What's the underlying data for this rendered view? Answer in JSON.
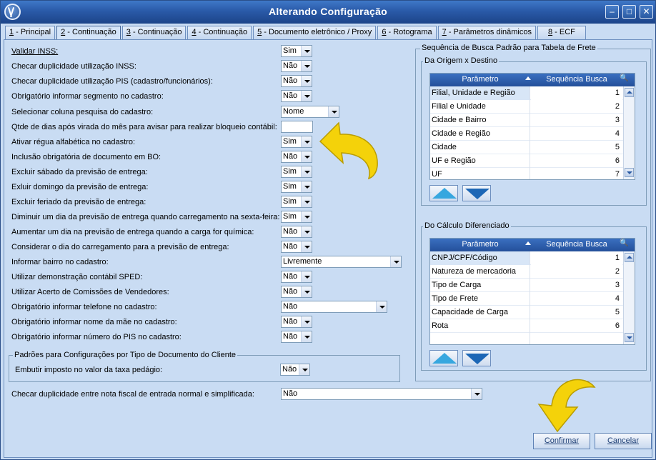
{
  "window": {
    "title": "Alterando Configuração",
    "controls": {
      "minimize": "–",
      "maximize": "□",
      "close": "✕"
    }
  },
  "tabs": [
    {
      "num": "1",
      "label": " - Principal"
    },
    {
      "num": "2",
      "label": " - Continuação",
      "active": true
    },
    {
      "num": "3",
      "label": " - Continuação"
    },
    {
      "num": "4",
      "label": " - Continuação"
    },
    {
      "num": "5",
      "label": " - Documento eletrônico / Proxy"
    },
    {
      "num": "6",
      "label": " - Rotograma"
    },
    {
      "num": "7",
      "label": " - Parâmetros dinâmicos"
    },
    {
      "num": "8",
      "label": " - ECF"
    }
  ],
  "settings": [
    {
      "label": "Validar INSS:",
      "value": "Sim"
    },
    {
      "label": "Checar duplicidade utilização INSS:",
      "value": "Não"
    },
    {
      "label": "Checar duplicidade utilização PIS (cadastro/funcionários):",
      "value": "Não"
    },
    {
      "label": "Obrigatório informar segmento no cadastro:",
      "value": "Não"
    },
    {
      "label": "Selecionar coluna pesquisa do cadastro:",
      "value": "Nome"
    },
    {
      "label": "Qtde de dias após virada do mês para avisar para realizar bloqueio contábil:",
      "value": ""
    },
    {
      "label": "Ativar régua alfabética no cadastro:",
      "value": "Sim"
    },
    {
      "label": "Inclusão obrigatória de documento em BO:",
      "value": "Não"
    },
    {
      "label": "Excluir sábado da previsão de entrega:",
      "value": "Sim"
    },
    {
      "label": "Exluir domingo da previsão de entrega:",
      "value": "Sim"
    },
    {
      "label": "Excluir feriado da previsão de entrega:",
      "value": "Sim"
    },
    {
      "label": "Diminuir um dia da previsão de entrega quando carregamento na sexta-feira:",
      "value": "Sim"
    },
    {
      "label": "Aumentar um dia na previsão de entrega quando a carga for química:",
      "value": "Não"
    },
    {
      "label": "Considerar o dia do carregamento para a previsão de entrega:",
      "value": "Não"
    },
    {
      "label": "Informar bairro no cadastro:",
      "value": "Livremente"
    },
    {
      "label": "Utilizar demonstração contábil SPED:",
      "value": "Não"
    },
    {
      "label": "Utilizar Acerto de Comissões de Vendedores:",
      "value": "Não"
    },
    {
      "label": "Obrigatório informar telefone no cadastro:",
      "value": "Não"
    },
    {
      "label": "Obrigatório informar nome da mãe no cadastro:",
      "value": "Não"
    },
    {
      "label": "Obrigatório informar número do PIS no cadastro:",
      "value": "Não"
    }
  ],
  "doc_group": {
    "title": "Padrões para Configurações por Tipo de Documento do Cliente",
    "label": "Embutir imposto no valor da taxa pedágio:",
    "value": "Não"
  },
  "nf_check": {
    "label": "Checar duplicidade entre nota fiscal de entrada normal e simplificada:",
    "value": "Não"
  },
  "search_group": {
    "title": "Sequência de Busca Padrão para Tabela de Frete",
    "origem": {
      "title": "Da Origem x Destino",
      "col_param": "Parâmetro",
      "col_seq": "Sequência Busca",
      "rows": [
        {
          "param": "Filial, Unidade e Região",
          "seq": "1"
        },
        {
          "param": "Filial e Unidade",
          "seq": "2"
        },
        {
          "param": "Cidade e Bairro",
          "seq": "3"
        },
        {
          "param": "Cidade e Região",
          "seq": "4"
        },
        {
          "param": "Cidade",
          "seq": "5"
        },
        {
          "param": "UF e Região",
          "seq": "6"
        },
        {
          "param": "UF",
          "seq": "7"
        }
      ]
    },
    "calculo": {
      "title": "Do Cálculo Diferenciado",
      "col_param": "Parâmetro",
      "col_seq": "Sequência Busca",
      "rows": [
        {
          "param": "CNPJ/CPF/Código",
          "seq": "1"
        },
        {
          "param": "Natureza de mercadoria",
          "seq": "2"
        },
        {
          "param": "Tipo de Carga",
          "seq": "3"
        },
        {
          "param": "Tipo de Frete",
          "seq": "4"
        },
        {
          "param": "Capacidade de Carga",
          "seq": "5"
        },
        {
          "param": "Rota",
          "seq": "6"
        }
      ]
    }
  },
  "buttons": {
    "confirm": "Confirmar",
    "cancel": "Cancelar"
  },
  "colors": {
    "callout_yellow": "#f4d20a",
    "titlebar": "#2a5aa8",
    "accent_blue": "#37a7df"
  }
}
